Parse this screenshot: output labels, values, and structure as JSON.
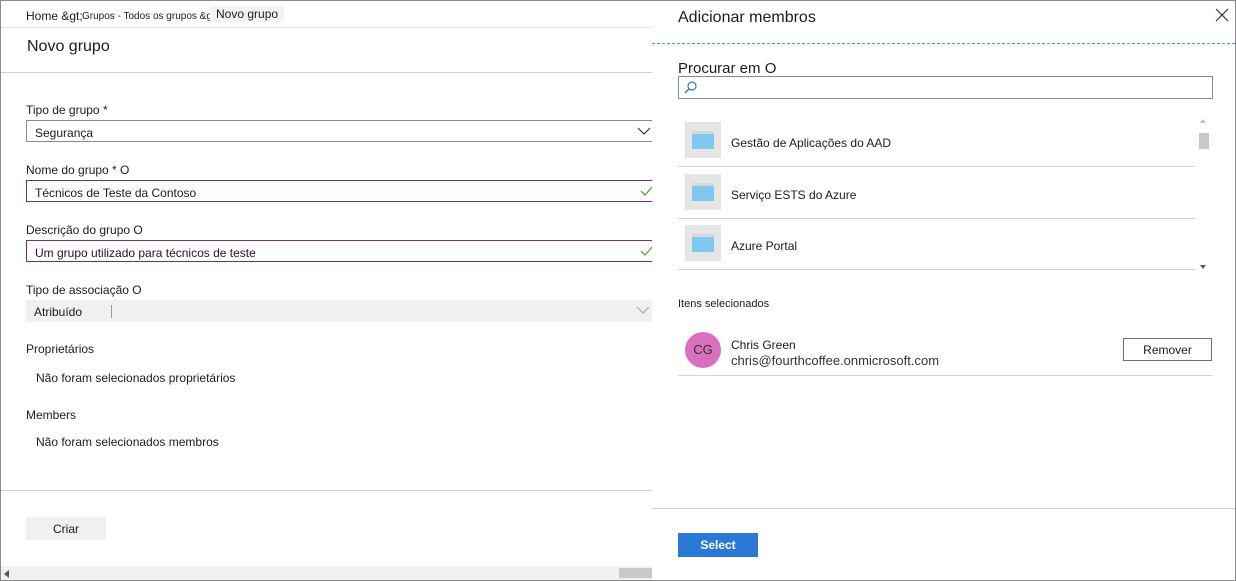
{
  "breadcrumb": {
    "home": "Home &gt;",
    "groups": "Grupos - Todos os grupos &gt;",
    "current": "Novo grupo"
  },
  "page": {
    "title": "Novo grupo"
  },
  "form": {
    "group_type": {
      "label": "Tipo de grupo *",
      "value": "Segurança"
    },
    "group_name": {
      "label": "Nome do grupo * O",
      "value": "Técnicos de Teste da Contoso"
    },
    "group_description": {
      "label": "Descrição do grupo O",
      "value": "Um grupo utilizado para técnicos de teste"
    },
    "membership_type": {
      "label": "Tipo de associação O",
      "value": "Atribuído"
    },
    "owners": {
      "label": "Proprietários",
      "value": "Não foram selecionados proprietários"
    },
    "members": {
      "label": "Members",
      "value": "Não foram selecionados membros"
    },
    "create_label": "Criar"
  },
  "panel": {
    "title": "Adicionar membros",
    "search_label": "Procurar em O",
    "search_value": "",
    "results": [
      {
        "name": "Gestão de Aplicações do AAD",
        "icon": "app-window-icon"
      },
      {
        "name": "Serviço ESTS do Azure",
        "icon": "app-window-icon"
      },
      {
        "name": "Azure Portal",
        "icon": "app-window-icon"
      }
    ],
    "selected_label": "Itens selecionados",
    "selected": [
      {
        "initials": "CG",
        "name": "Chris Green",
        "email": "chris@fourthcoffee.onmicrosoft.com",
        "remove_label": "Remover"
      }
    ],
    "select_label": "Select"
  },
  "colors": {
    "accent": "#2b79d6",
    "valid_border": "#7a2782",
    "valid_check": "#5aa33c",
    "avatar": "#da6fc0",
    "divider_dashed": "#3e9ad6"
  }
}
